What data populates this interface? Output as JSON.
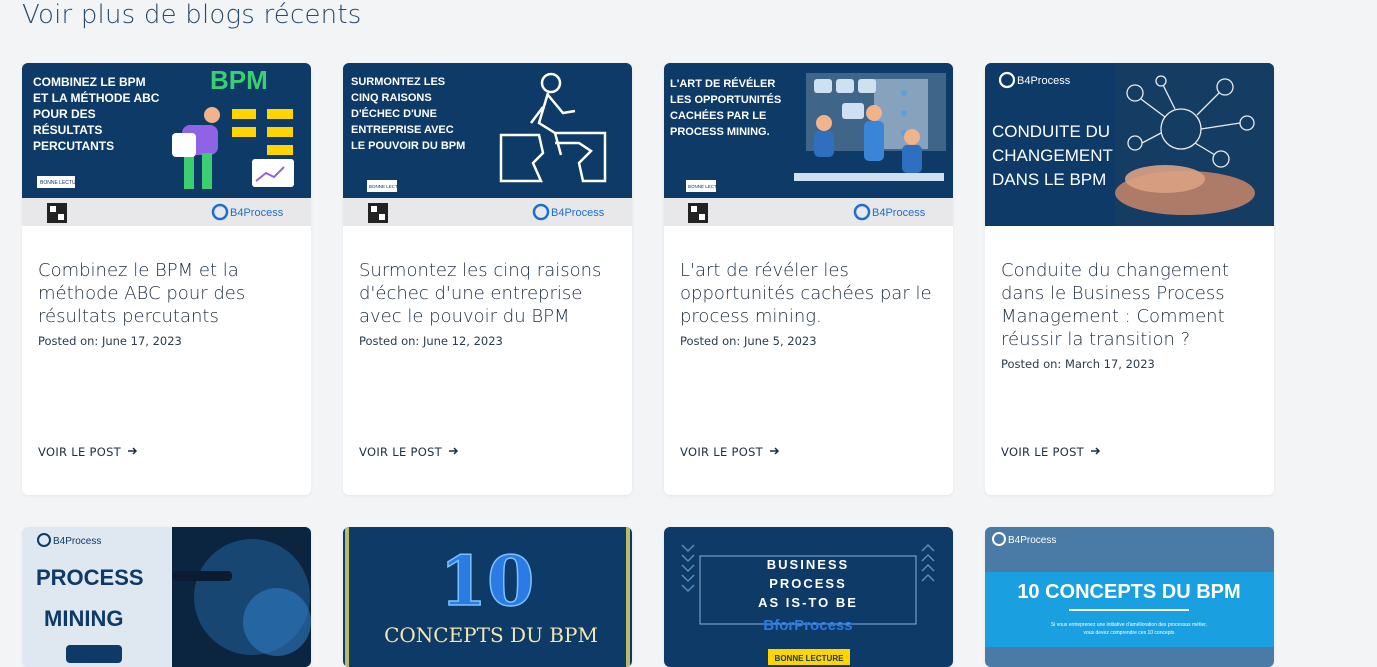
{
  "section": {
    "title": "Voir plus de blogs récents"
  },
  "cards": [
    {
      "title": "Combinez le BPM et la méthode ABC pour des résultats percutants",
      "date": "Posted on: June 17, 2023",
      "cta": "VOIR LE POST",
      "thumb": {
        "headline": [
          "COMBINEZ LE BPM",
          "ET LA MÉTHODE ABC",
          "POUR DES",
          "RÉSULTATS",
          "PERCUTANTS"
        ],
        "big": "BPM",
        "tag": "BONNE LECTURE",
        "brand": "B4Process"
      }
    },
    {
      "title": "Surmontez les cinq raisons d'échec d'une entreprise avec le pouvoir du BPM",
      "date": "Posted on: June 12, 2023",
      "cta": "VOIR LE POST",
      "thumb": {
        "headline": [
          "SURMONTEZ LES",
          "CINQ RAISONS",
          "D'ÉCHEC D'UNE",
          "ENTREPRISE AVEC",
          "LE POUVOIR DU BPM"
        ],
        "tag": "BONNE LECTURE",
        "brand": "B4Process"
      }
    },
    {
      "title": "L'art de révéler les opportunités cachées par le process mining.",
      "date": "Posted on: June 5, 2023",
      "cta": "VOIR LE POST",
      "thumb": {
        "headline": [
          "L'ART DE RÉVÉLER",
          "LES OPPORTUNITÉS",
          "CACHÉES PAR LE",
          "PROCESS MINING."
        ],
        "tag": "BONNE LECTURE",
        "brand": "B4Process"
      }
    },
    {
      "title": "Conduite du changement dans le Business Process Management : Comment réussir la transition ?",
      "date": "Posted on: March 17, 2023",
      "cta": "VOIR LE POST",
      "thumb": {
        "headline": [
          "CONDUITE DU",
          "CHANGEMENT",
          "DANS LE BPM"
        ],
        "brand": "B4Process"
      }
    }
  ],
  "bottom_cards": [
    {
      "brand": "B4Process",
      "headline": [
        "PROCESS",
        "MINING"
      ]
    },
    {
      "big": "10",
      "headline": "CONCEPTS DU BPM"
    },
    {
      "headline": [
        "BUSINESS",
        "PROCESS",
        "AS IS-TO BE"
      ],
      "brand": "BforProcess",
      "tag": "BONNE LECTURE"
    },
    {
      "brand": "B4Process",
      "headline": "10 CONCEPTS DU BPM",
      "sub": [
        "Si vous entreprenez une initiative d'amélioration des processus métier,",
        "vous devez comprendre ces 10 concepts"
      ]
    }
  ],
  "colors": {
    "navy": "#0d3a66",
    "accent_yellow": "#ffd400",
    "brand_blue": "#1a6fd0"
  }
}
